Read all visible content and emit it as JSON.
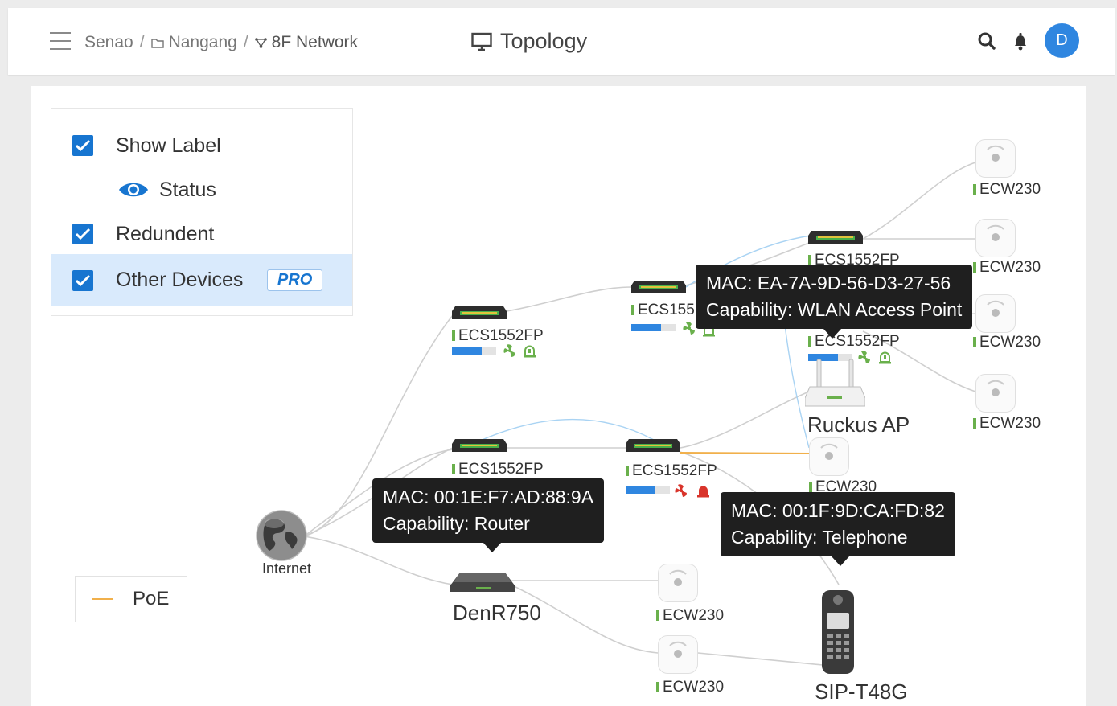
{
  "header": {
    "breadcrumb": [
      "Senao",
      "Nangang",
      "8F Network"
    ],
    "breadcrumb_sep": "/",
    "title": "Topology",
    "avatar_letter": "D",
    "icons": [
      "menu-icon",
      "folder-icon",
      "network-icon",
      "monitor-icon",
      "search-icon",
      "bell-icon"
    ]
  },
  "options": {
    "show_label": "Show Label",
    "status": "Status",
    "redundant": "Redundent",
    "other_devices": "Other Devices",
    "pro_badge": "PRO",
    "checked": {
      "show_label": true,
      "redundant": true,
      "other_devices": true
    }
  },
  "legend": {
    "poe_label": "PoE",
    "poe_color": "#f1b04b"
  },
  "nodes": {
    "internet": "Internet",
    "router": "DenR750",
    "ruckus": "Ruckus AP",
    "phone": "SIP-T48G",
    "switch_a": "ECS1552FP",
    "switch_b": "ECS155",
    "switch_c": "ECS1552FP",
    "switch_d": "ECS1552FP",
    "switch_e": "ECS1552FP",
    "switch_f": "ECS1552FP",
    "ecw_r1": "ECW230",
    "ecw_r2": "ECW230",
    "ecw_r3": "ECW230",
    "ecw_r4": "ECW230",
    "ecw_mid": "ECW230",
    "ecw_b1": "ECW230",
    "ecw_b2": "ECW230"
  },
  "bars": {
    "switch_a": 0.68,
    "switch_b": 0.68,
    "switch_d": 0.68,
    "switch_f": 0.68
  },
  "tooltips": {
    "wlan": {
      "mac": "MAC: EA-7A-9D-56-D3-27-56",
      "cap": "Capability: WLAN Access Point"
    },
    "router": {
      "mac": "MAC: 00:1E:F7:AD:88:9A",
      "cap": "Capability: Router"
    },
    "phone": {
      "mac": "MAC: 00:1F:9D:CA:FD:82",
      "cap": "Capability: Telephone"
    }
  },
  "colors": {
    "accent": "#1775d0",
    "status_ok": "#6ab04c",
    "status_alarm": "#d9342b",
    "link": "#cfcfcf",
    "redundant_link": "#a9d3f3"
  }
}
